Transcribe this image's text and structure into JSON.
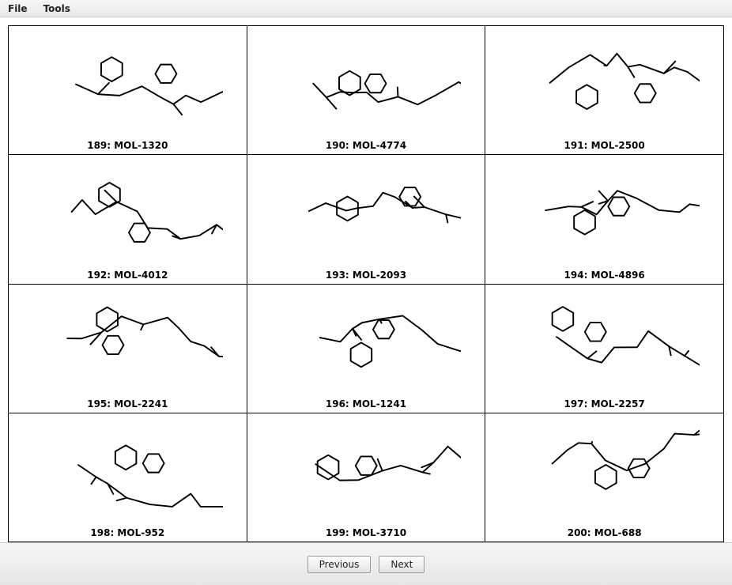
{
  "menu": {
    "file": "File",
    "tools": "Tools"
  },
  "cells": [
    {
      "index": 189,
      "id": "MOL-1320",
      "label": "189: MOL-1320"
    },
    {
      "index": 190,
      "id": "MOL-4774",
      "label": "190: MOL-4774"
    },
    {
      "index": 191,
      "id": "MOL-2500",
      "label": "191: MOL-2500"
    },
    {
      "index": 192,
      "id": "MOL-4012",
      "label": "192: MOL-4012"
    },
    {
      "index": 193,
      "id": "MOL-2093",
      "label": "193: MOL-2093"
    },
    {
      "index": 194,
      "id": "MOL-4896",
      "label": "194: MOL-4896"
    },
    {
      "index": 195,
      "id": "MOL-2241",
      "label": "195: MOL-2241"
    },
    {
      "index": 196,
      "id": "MOL-1241",
      "label": "196: MOL-1241"
    },
    {
      "index": 197,
      "id": "MOL-2257",
      "label": "197: MOL-2257"
    },
    {
      "index": 198,
      "id": "MOL-952",
      "label": "198: MOL-952"
    },
    {
      "index": 199,
      "id": "MOL-3710",
      "label": "199: MOL-3710"
    },
    {
      "index": 200,
      "id": "MOL-688",
      "label": "200: MOL-688"
    }
  ],
  "footer": {
    "previous": "Previous",
    "next": "Next"
  }
}
